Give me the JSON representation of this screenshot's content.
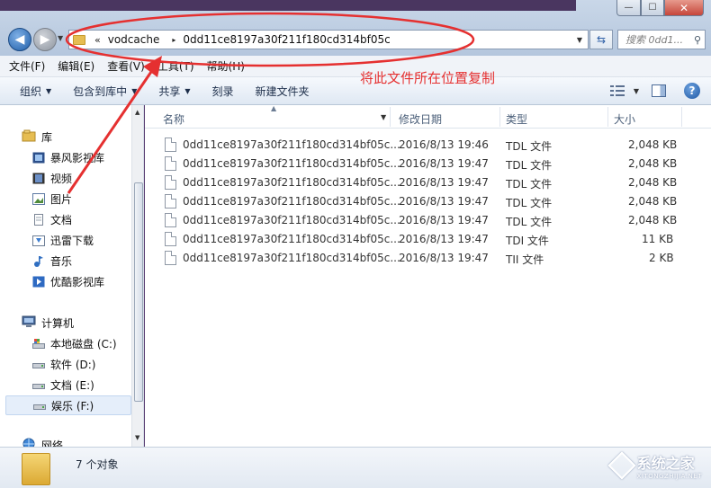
{
  "window": {
    "controls": {
      "minimize": "—",
      "maximize": "☐",
      "close": "✕"
    }
  },
  "address": {
    "prefix": "«",
    "crumbs": [
      "vodcache",
      "0dd11ce8197a30f211f180cd314bf05c"
    ],
    "separator": "▸",
    "search_placeholder": "搜索 0dd1..."
  },
  "menubar": [
    "文件(F)",
    "编辑(E)",
    "查看(V)",
    "工具(T)",
    "帮助(H)"
  ],
  "toolbar": {
    "organize": "组织",
    "include_library": "包含到库中",
    "share": "共享",
    "burn": "刻录",
    "new_folder": "新建文件夹",
    "help": "?"
  },
  "navpane": {
    "library": "库",
    "library_items": [
      "暴风影视库",
      "视频",
      "图片",
      "文档",
      "迅雷下载",
      "音乐",
      "优酷影视库"
    ],
    "computer": "计算机",
    "drives": [
      "本地磁盘 (C:)",
      "软件 (D:)",
      "文档 (E:)",
      "娱乐 (F:)"
    ],
    "network": "网络"
  },
  "columns": {
    "name": "名称",
    "modified": "修改日期",
    "type": "类型",
    "size": "大小"
  },
  "files": [
    {
      "name": "0dd11ce8197a30f211f180cd314bf05c...",
      "modified": "2016/8/13 19:46",
      "type": "TDL 文件",
      "size": "2,048 KB"
    },
    {
      "name": "0dd11ce8197a30f211f180cd314bf05c...",
      "modified": "2016/8/13 19:47",
      "type": "TDL 文件",
      "size": "2,048 KB"
    },
    {
      "name": "0dd11ce8197a30f211f180cd314bf05c...",
      "modified": "2016/8/13 19:47",
      "type": "TDL 文件",
      "size": "2,048 KB"
    },
    {
      "name": "0dd11ce8197a30f211f180cd314bf05c...",
      "modified": "2016/8/13 19:47",
      "type": "TDL 文件",
      "size": "2,048 KB"
    },
    {
      "name": "0dd11ce8197a30f211f180cd314bf05c...",
      "modified": "2016/8/13 19:47",
      "type": "TDL 文件",
      "size": "2,048 KB"
    },
    {
      "name": "0dd11ce8197a30f211f180cd314bf05c...",
      "modified": "2016/8/13 19:47",
      "type": "TDI 文件",
      "size": "11 KB"
    },
    {
      "name": "0dd11ce8197a30f211f180cd314bf05c...",
      "modified": "2016/8/13 19:47",
      "type": "TII 文件",
      "size": "2 KB"
    }
  ],
  "status": {
    "count": "7 个对象"
  },
  "annotation": {
    "text": "将此文件所在位置复制",
    "color": "#e53030"
  },
  "watermark": {
    "name": "系统之家",
    "domain": "XITONGZHIJIA.NET"
  }
}
